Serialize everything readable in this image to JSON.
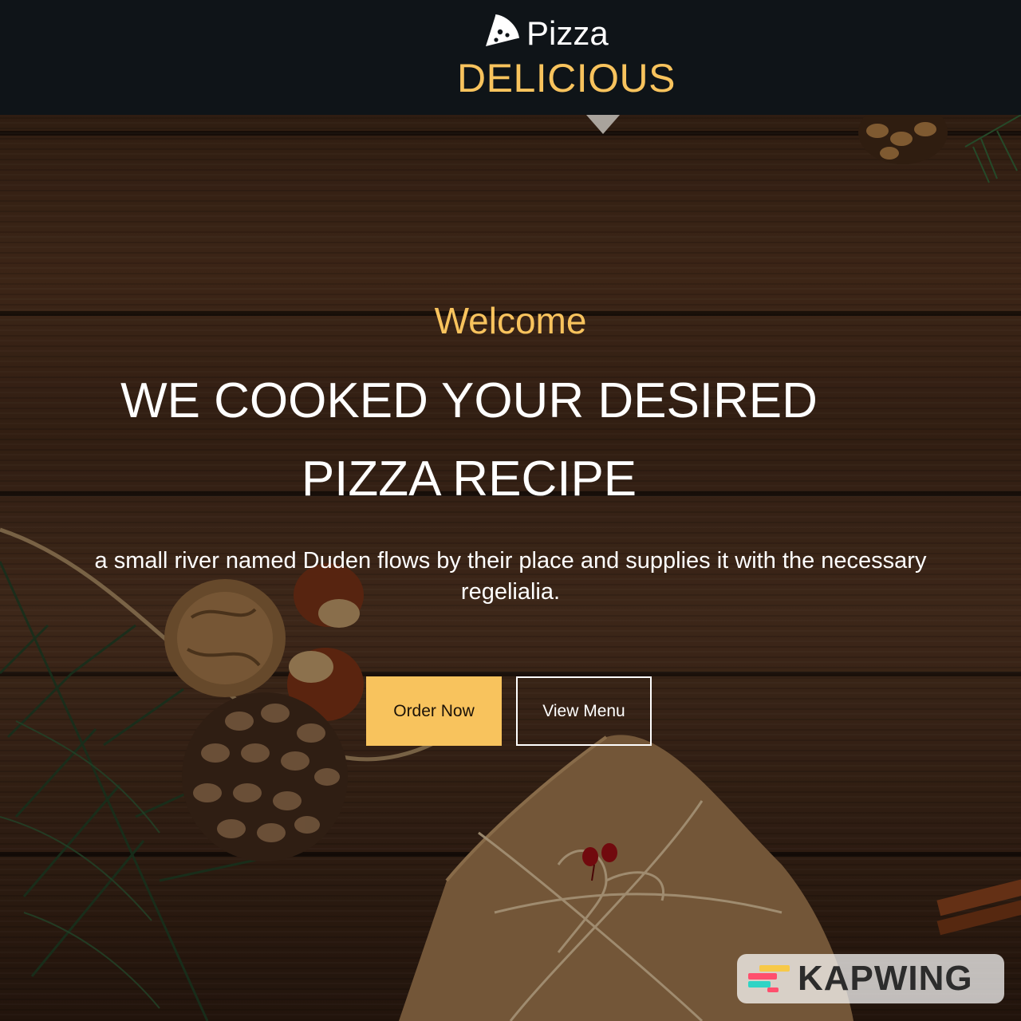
{
  "header": {
    "brand_line1": "Pizza",
    "brand_line2": "DELICIOUS",
    "logo_icon": "pizza-slice-icon"
  },
  "hero": {
    "welcome": "Welcome",
    "headline": "WE COOKED YOUR DESIRED PIZZA RECIPE",
    "tagline": "a small river named Duden flows by their place and supplies it with the necessary regelialia.",
    "order_button": "Order Now",
    "menu_button": "View Menu"
  },
  "watermark": {
    "text": "KAPWING",
    "icon": "kapwing-logo-icon"
  },
  "colors": {
    "accent": "#f8c35d",
    "header_bg": "#0f1418",
    "text_light": "#ffffff"
  }
}
